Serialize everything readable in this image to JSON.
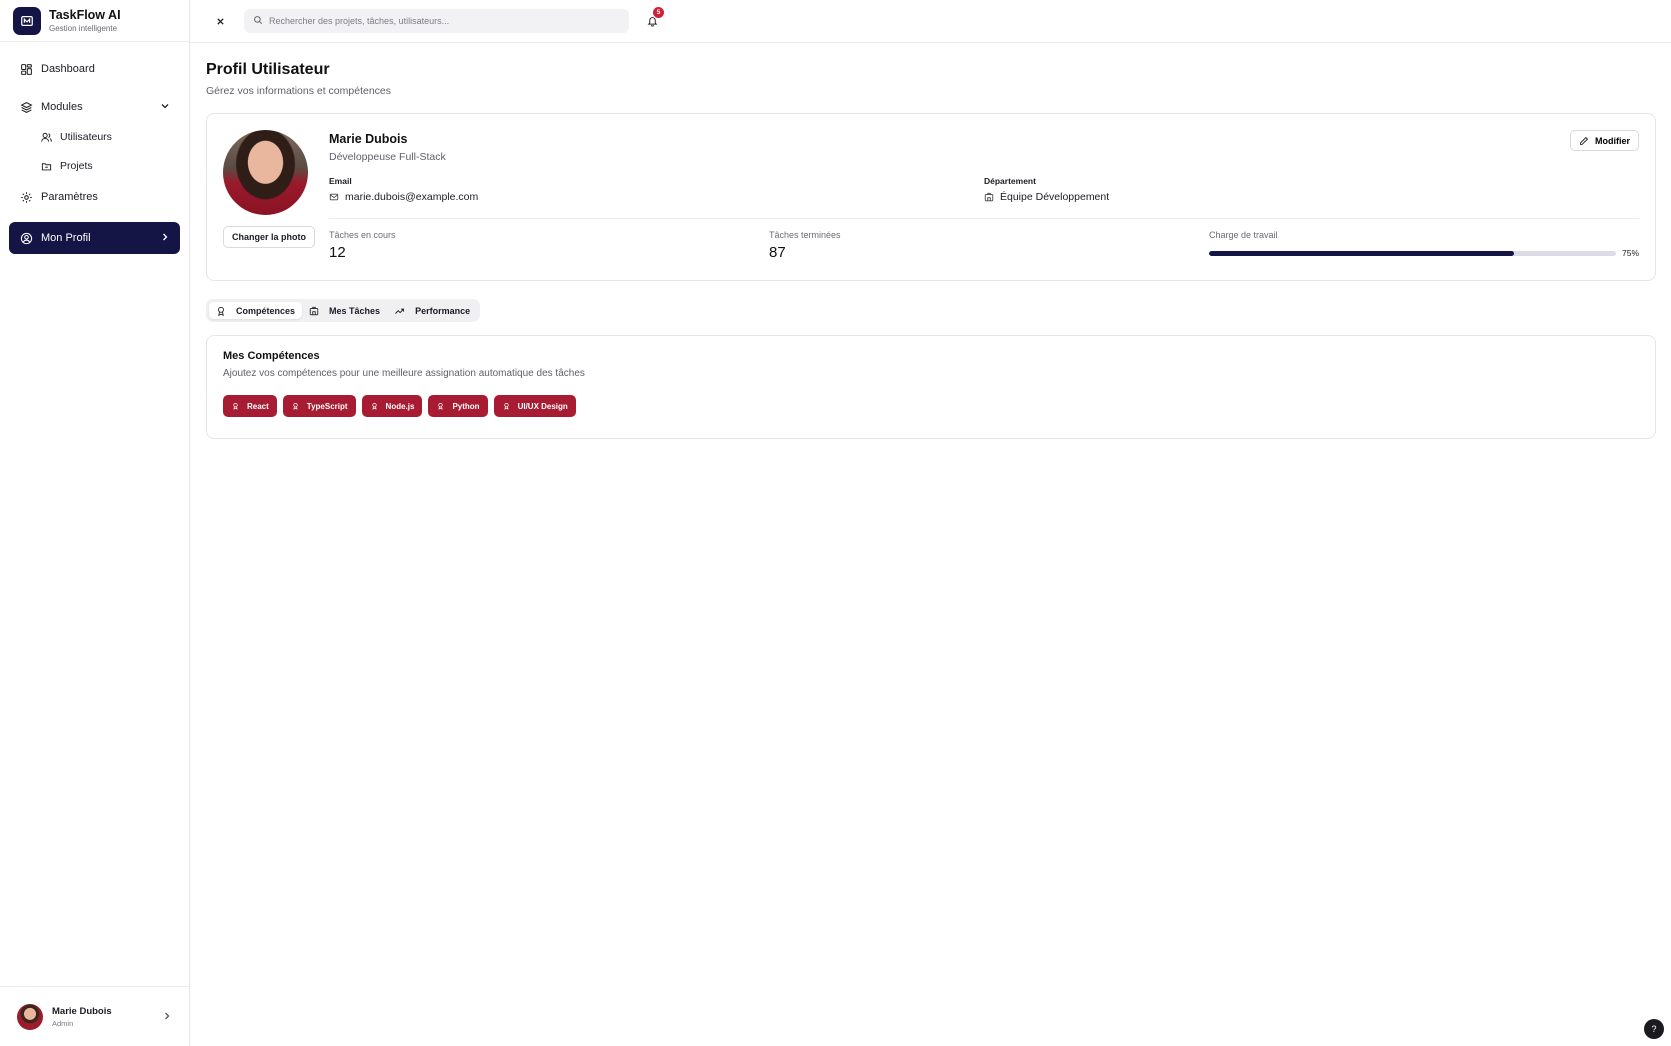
{
  "brand": {
    "title": "TaskFlow AI",
    "subtitle": "Gestion intelligente"
  },
  "sidebar": {
    "items": [
      {
        "label": "Dashboard",
        "icon": "dashboard-icon"
      },
      {
        "label": "Modules",
        "icon": "layers-icon"
      },
      {
        "label": "Utilisateurs",
        "icon": "users-icon"
      },
      {
        "label": "Projets",
        "icon": "folder-icon"
      },
      {
        "label": "Paramètres",
        "icon": "gear-icon"
      },
      {
        "label": "Mon Profil",
        "icon": "user-circle-icon",
        "active": true
      }
    ],
    "user": {
      "name": "Marie Dubois",
      "role": "Admin"
    }
  },
  "topbar": {
    "search_placeholder": "Rechercher des projets, tâches, utilisateurs...",
    "notifications": "5"
  },
  "page": {
    "title": "Profil Utilisateur",
    "subtitle": "Gérez vos informations et compétences"
  },
  "profile": {
    "name": "Marie Dubois",
    "role": "Développeuse Full-Stack",
    "change_photo": "Changer la photo",
    "edit_label": "Modifier",
    "email_label": "Email",
    "email": "marie.dubois@example.com",
    "department_label": "Département",
    "department": "Équipe Développement",
    "stats": {
      "in_progress_label": "Tâches en cours",
      "in_progress": "12",
      "done_label": "Tâches terminées",
      "done": "87",
      "workload_label": "Charge de travail",
      "workload_pct": 75,
      "workload_text": "75%"
    }
  },
  "tabs": [
    {
      "label": "Compétences",
      "icon": "award-icon",
      "active": true
    },
    {
      "label": "Mes Tâches",
      "icon": "building-icon"
    },
    {
      "label": "Performance",
      "icon": "trending-up-icon"
    }
  ],
  "skills": {
    "title": "Mes Compétences",
    "subtitle": "Ajoutez vos compétences pour une meilleure assignation automatique des tâches",
    "items": [
      "React",
      "TypeScript",
      "Node.js",
      "Python",
      "UI/UX Design"
    ]
  },
  "help": "?",
  "colors": {
    "primary": "#141445",
    "accent": "#a71c32",
    "badge": "#d0213a"
  }
}
